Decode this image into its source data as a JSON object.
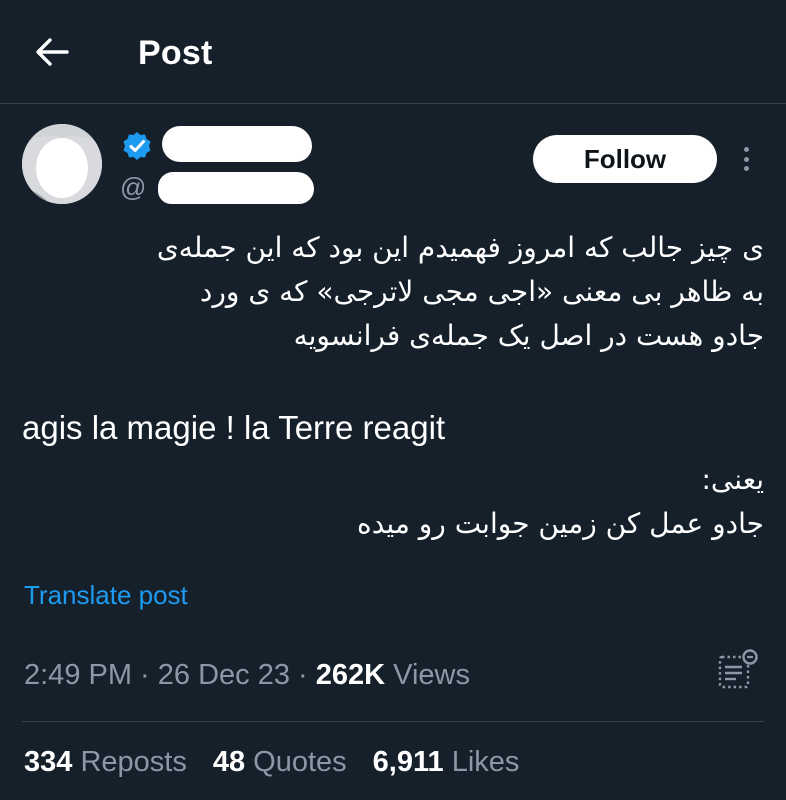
{
  "header": {
    "title": "Post"
  },
  "author": {
    "handle_prefix": "@"
  },
  "follow_button": {
    "label": "Follow"
  },
  "post": {
    "paragraph1": [
      "ی چیز جالب که امروز فهمیدم این بود که این جمله‌ی",
      "به ظاهر بی معنی «اجی مجی لاترجی» که ی ورد",
      "جادو هست در اصل یک جمله‌ی فرانسویه"
    ],
    "french_line": "agis la magie ! la Terre reagit",
    "paragraph2": [
      "یعنی:",
      "جادو عمل کن زمین جوابت رو میده"
    ],
    "translate_label": "Translate post"
  },
  "meta": {
    "time": "2:49 PM",
    "separator": " · ",
    "date": "26 Dec 23",
    "views_count": "262K",
    "views_label": " Views"
  },
  "stats": {
    "reposts": {
      "count": "334",
      "label": " Reposts"
    },
    "quotes": {
      "count": "48",
      "label": " Quotes"
    },
    "likes": {
      "count": "6,911",
      "label": " Likes"
    }
  },
  "colors": {
    "background": "#15202b",
    "accent": "#1d9bf0",
    "muted": "#8b98a5",
    "divider": "#38444d"
  },
  "icons": {
    "back": "arrow-left-icon",
    "verified": "verified-badge-icon",
    "more": "more-vertical-icon",
    "analytics": "analytics-icon"
  }
}
